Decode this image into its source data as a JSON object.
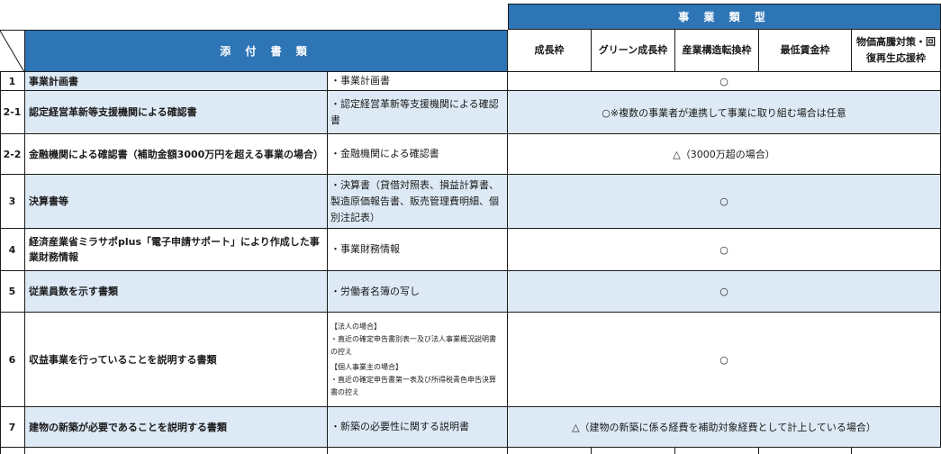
{
  "header": {
    "group_title": "事 業 類 型",
    "attach_title": "添 付 書 類",
    "columns": [
      "成長枠",
      "グリーン成長枠",
      "産業構造転換枠",
      "最低賃金枠",
      "物価高騰対策・回復再生応援枠"
    ]
  },
  "rows": [
    {
      "no": "1",
      "name": "事業計画書",
      "doc": "・事業計画書",
      "req": "○"
    },
    {
      "no": "2-1",
      "name": "認定経営革新等支援機関による確認書",
      "doc": "・認定経営革新等支援機関による確認書",
      "req": "○※複数の事業者が連携して事業に取り組む場合は任意"
    },
    {
      "no": "2-2",
      "name": "金融機関による確認書（補助金額3000万円を超える事業の場合）",
      "doc": "・金融機関による確認書",
      "req": "△（3000万超の場合）"
    },
    {
      "no": "3",
      "name": "決算書等",
      "doc": "・決算書（貸借対照表、損益計算書、製造原価報告書、販売管理費明細、個別注記表）",
      "req": "○"
    },
    {
      "no": "4",
      "name": "経済産業省ミラサポplus「電子申請サポート」により作成した事業財務情報",
      "doc": "・事業財務情報",
      "req": "○"
    },
    {
      "no": "5",
      "name": "従業員数を示す書類",
      "doc": "・労働者名簿の写し",
      "req": "○"
    },
    {
      "no": "6",
      "name": "収益事業を行っていることを説明する書類",
      "doc_lines": [
        "【法人の場合】",
        "・直近の確定申告書別表一及び法人事業概況説明書の控え",
        "【個人事業主の場合】",
        "・直近の確定申告書第一表及び所得税青色申告決算書の控え"
      ],
      "req": "○"
    },
    {
      "no": "7",
      "name": "建物の新築が必要であることを説明する書類",
      "doc": "・新築の必要性に関する説明書",
      "req": "△（建物の新築に係る経費を補助対象経費として計上している場合）"
    }
  ]
}
